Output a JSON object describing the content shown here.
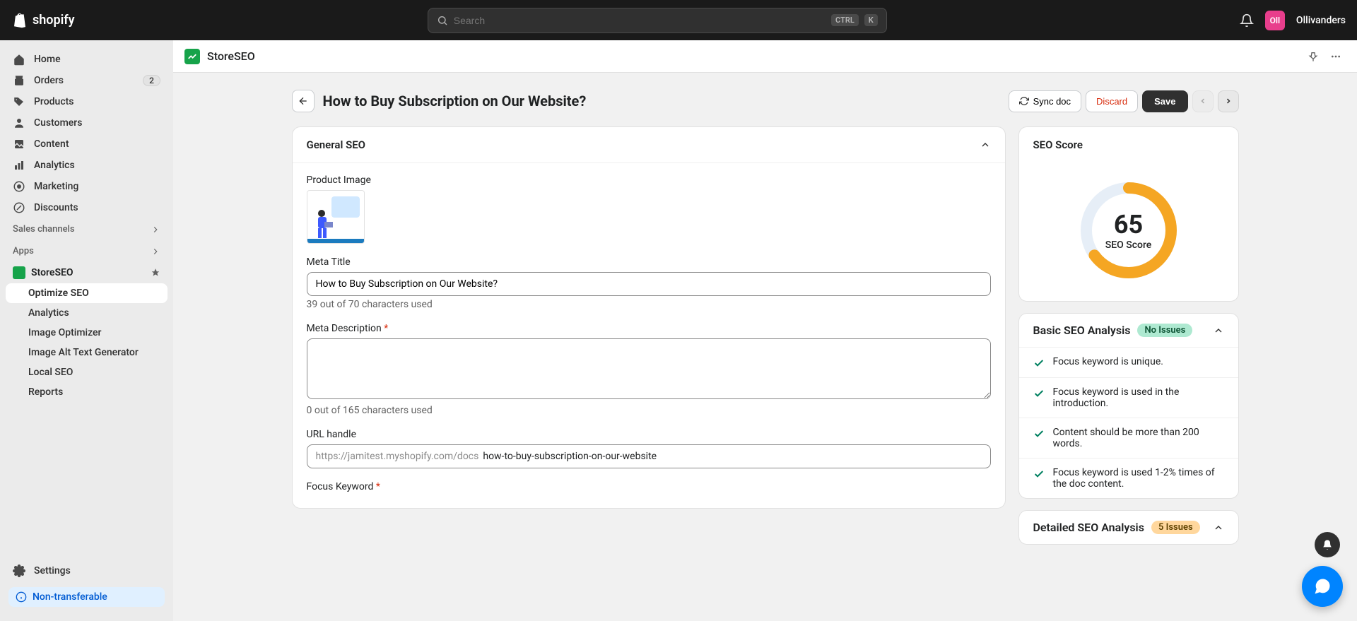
{
  "topbar": {
    "logo_text": "shopify",
    "search_placeholder": "Search",
    "kbd_ctrl": "CTRL",
    "kbd_k": "K",
    "avatar_initials": "Oll",
    "store_name": "Ollivanders"
  },
  "sidebar": {
    "items": [
      {
        "label": "Home"
      },
      {
        "label": "Orders",
        "badge": "2"
      },
      {
        "label": "Products"
      },
      {
        "label": "Customers"
      },
      {
        "label": "Content"
      },
      {
        "label": "Analytics"
      },
      {
        "label": "Marketing"
      },
      {
        "label": "Discounts"
      }
    ],
    "sales_channels_label": "Sales channels",
    "apps_label": "Apps",
    "app": {
      "name": "StoreSEO",
      "children": [
        {
          "label": "Optimize SEO",
          "active": true
        },
        {
          "label": "Analytics"
        },
        {
          "label": "Image Optimizer"
        },
        {
          "label": "Image Alt Text Generator"
        },
        {
          "label": "Local SEO"
        },
        {
          "label": "Reports"
        }
      ]
    },
    "settings_label": "Settings",
    "non_transferable": "Non-transferable"
  },
  "app_header": {
    "app_name": "StoreSEO"
  },
  "page": {
    "title": "How to Buy Subscription on Our Website?",
    "sync_doc": "Sync doc",
    "discard": "Discard",
    "save": "Save"
  },
  "general_seo": {
    "card_title": "General SEO",
    "product_image_label": "Product Image",
    "meta_title_label": "Meta Title",
    "meta_title_value": "How to Buy Subscription on Our Website?",
    "meta_title_help": "39 out of 70 characters used",
    "meta_desc_label": "Meta Description",
    "meta_desc_value": "",
    "meta_desc_help": "0 out of 165 characters used",
    "url_handle_label": "URL handle",
    "url_prefix": "https://jamitest.myshopify.com/docs",
    "url_handle_value": "how-to-buy-subscription-on-our-website",
    "focus_keyword_label": "Focus Keyword"
  },
  "seo_score": {
    "card_title": "SEO Score",
    "value": "65",
    "label": "SEO Score"
  },
  "basic_analysis": {
    "title": "Basic SEO Analysis",
    "chip": "No Issues",
    "items": [
      "Focus keyword is unique.",
      "Focus keyword is used in the introduction.",
      "Content should be more than 200 words.",
      "Focus keyword is used 1-2% times of the doc content."
    ]
  },
  "detailed_analysis": {
    "title": "Detailed SEO Analysis",
    "chip": "5 Issues"
  },
  "colors": {
    "accent_orange": "#f5a623",
    "track": "#e6eef7"
  }
}
